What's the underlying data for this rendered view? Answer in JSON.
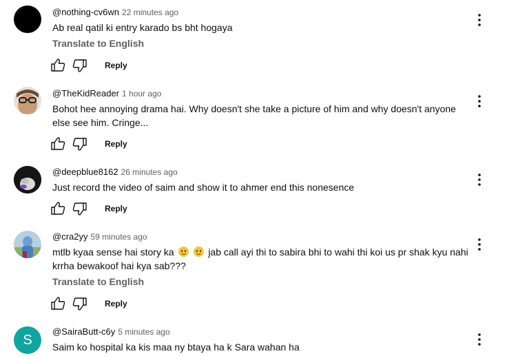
{
  "labels": {
    "translate": "Translate to English",
    "reply": "Reply"
  },
  "comments": [
    {
      "author": "@nothing-cv6wn",
      "time": "22 minutes ago",
      "text": "Ab real qatil ki entry karado bs bht hogaya",
      "avatar_color": "#000000"
    },
    {
      "author": "@TheKidReader",
      "time": "1 hour ago",
      "text": "Bohot hee annoying drama hai. Why doesn't she take a picture of him and why doesn't anyone else see him. Cringe...",
      "avatar_color": "#c9a48a"
    },
    {
      "author": "@deepblue8162",
      "time": "26 minutes ago",
      "text": "Just record the video of saim and show it to ahmer end this nonesence",
      "avatar_color": "#1a1a1a"
    },
    {
      "author": "@cra2yy",
      "time": "59 minutes ago",
      "text_part1": "mtlb kyaa sense hai story ka",
      "text_part2": "jab call ayi thi to sabira bhi to wahi thi koi us pr shak kyu nahi krrha bewakoof hai kya sab???",
      "avatar_color": "#7fa3c9"
    },
    {
      "author": "@SairaButt-c6y",
      "time": "5 minutes ago",
      "text": "Saim ko hospital ka kis maa ny btaya ha k Sara wahan ha",
      "avatar_letter": "S",
      "avatar_color": "#12a4a0"
    }
  ]
}
